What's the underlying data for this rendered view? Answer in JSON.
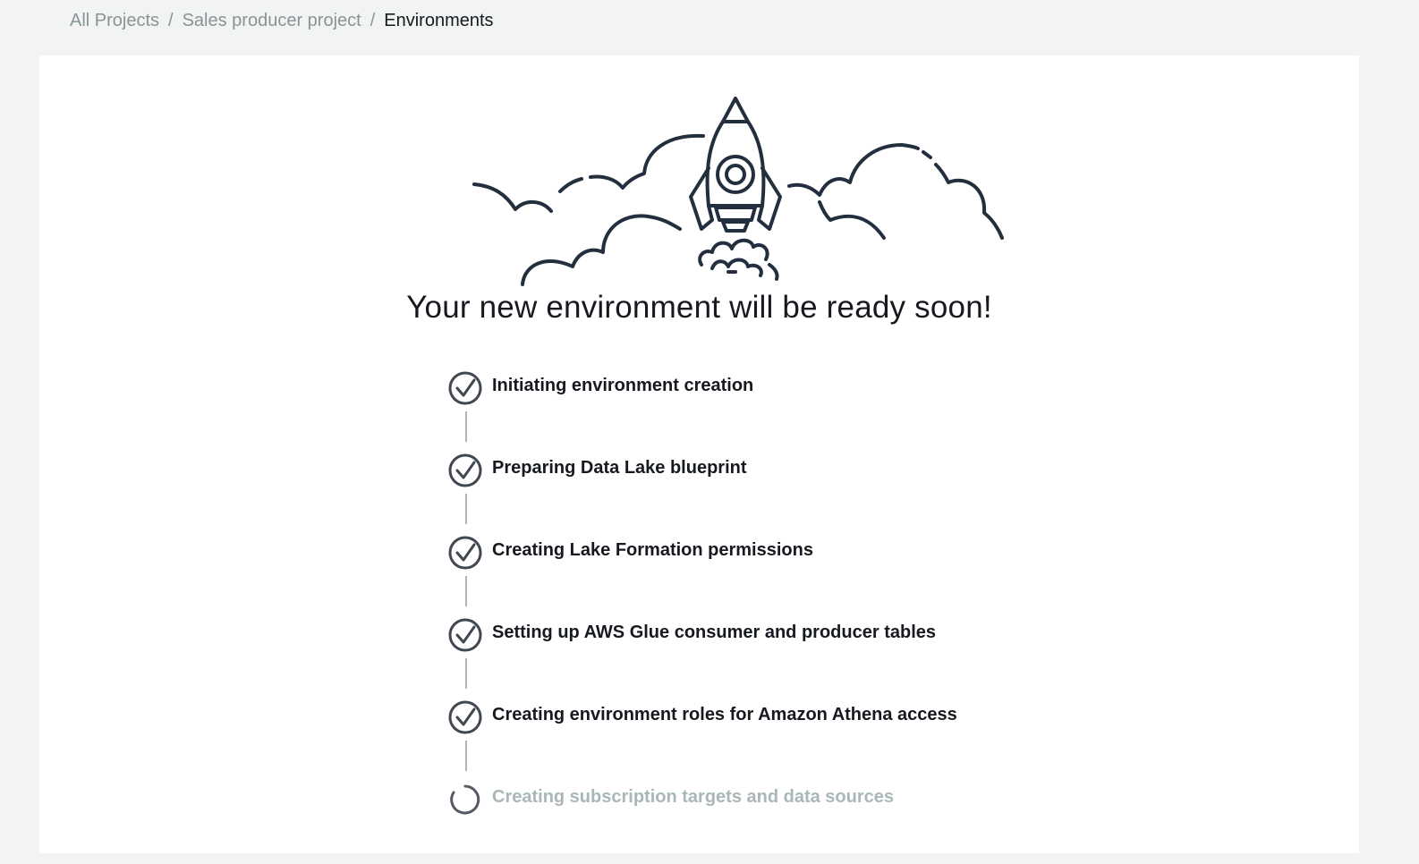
{
  "breadcrumb": {
    "items": [
      "All Projects",
      "Sales producer project"
    ],
    "current": "Environments",
    "separator": "/"
  },
  "main": {
    "headline": "Your new environment will be ready soon!",
    "illustration": "rocket-launch-illustration",
    "steps": [
      {
        "label": "Initiating environment creation",
        "status": "complete",
        "icon": "check-circle-icon"
      },
      {
        "label": "Preparing Data Lake blueprint",
        "status": "complete",
        "icon": "check-circle-icon"
      },
      {
        "label": "Creating Lake Formation permissions",
        "status": "complete",
        "icon": "check-circle-icon"
      },
      {
        "label": "Setting up AWS Glue consumer and producer tables",
        "status": "complete",
        "icon": "check-circle-icon"
      },
      {
        "label": "Creating environment roles for Amazon Athena access",
        "status": "complete",
        "icon": "check-circle-icon"
      },
      {
        "label": "Creating subscription targets and data sources",
        "status": "in-progress",
        "icon": "spinner-icon"
      }
    ]
  },
  "colors": {
    "text_primary": "#16191f",
    "text_muted": "#879596",
    "text_pending": "#aab7b8",
    "background": "#f2f3f3",
    "card": "#ffffff"
  }
}
